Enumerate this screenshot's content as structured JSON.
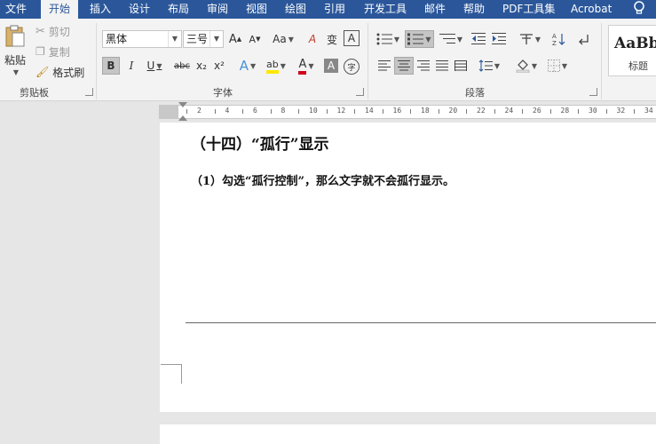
{
  "menu": {
    "items": [
      "文件",
      "开始",
      "插入",
      "设计",
      "布局",
      "审阅",
      "视图",
      "绘图",
      "引用",
      "开发工具",
      "邮件",
      "帮助",
      "PDF工具集",
      "Acrobat"
    ],
    "active": "开始"
  },
  "ribbon": {
    "clipboard": {
      "paste": "粘贴",
      "cut": "剪切",
      "copy": "复制",
      "format_painter": "格式刷",
      "label": "剪贴板"
    },
    "font": {
      "family": "黑体",
      "size": "三号",
      "grow": "A",
      "shrink": "A",
      "case": "Aa",
      "clear": "A",
      "phonetic": "变",
      "border": "A",
      "bold": "B",
      "italic": "I",
      "underline": "U",
      "strike": "abc",
      "sub": "x₂",
      "sup": "x²",
      "effects": "A",
      "highlight": "ab",
      "color": "A",
      "shade": "A",
      "enclose": "字",
      "label": "字体"
    },
    "paragraph": {
      "label": "段落"
    },
    "styles": {
      "preview": "AaBb",
      "name": "标题"
    }
  },
  "ruler": {
    "numbers": [
      "2",
      "4",
      "6",
      "8",
      "10",
      "12",
      "14",
      "16",
      "18",
      "20",
      "22",
      "24",
      "26",
      "28",
      "30",
      "32",
      "34"
    ]
  },
  "document": {
    "heading": "（十四）“孤行”显示",
    "paragraph": "（1）勾选“孤行控制”，那么文字就不会孤行显示。"
  }
}
